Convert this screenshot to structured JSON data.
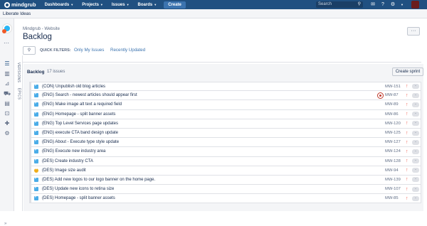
{
  "topnav": {
    "logo": "mindgrub",
    "items": [
      {
        "label": "Dashboards"
      },
      {
        "label": "Projects"
      },
      {
        "label": "Issues"
      },
      {
        "label": "Boards"
      }
    ],
    "create_label": "Create",
    "search_placeholder": "Search"
  },
  "project_bar": {
    "title": "Liberate Ideas"
  },
  "sidebar": {
    "vtabs": [
      "VERSIONS",
      "EPICS"
    ],
    "collapse": "»"
  },
  "header": {
    "breadcrumb": "Mindgrub - Website",
    "title": "Backlog",
    "more": "···"
  },
  "quick_filters": {
    "label": "QUICK FILTERS:",
    "links": [
      "Only My Issues",
      "Recently Updated"
    ]
  },
  "backlog": {
    "title": "Backlog",
    "count": "17 issues",
    "create_sprint_label": "Create sprint",
    "issues": [
      {
        "type": "task",
        "summary": "(CON) Unpublish old blog articles",
        "key": "MW-151",
        "est": "-",
        "avatar": false
      },
      {
        "type": "task",
        "summary": "(ENG) Search - newest articles should appear first",
        "key": "MW-87",
        "est": "-",
        "avatar": true
      },
      {
        "type": "task",
        "summary": "(ENG) Make image alt text a required field",
        "key": "MW-89",
        "est": "-",
        "avatar": false
      },
      {
        "type": "task",
        "summary": "(ENG) Homepage - split banner assets",
        "key": "MW-86",
        "est": "-",
        "avatar": false
      },
      {
        "type": "task",
        "summary": "(ENG) Top Level Services page updates",
        "key": "MW-120",
        "est": "-",
        "avatar": false
      },
      {
        "type": "task",
        "summary": "(ENG) execute CTA band design update",
        "key": "MW-125",
        "est": "-",
        "avatar": false
      },
      {
        "type": "task",
        "summary": "(ENG) About - Execute type style update",
        "key": "MW-127",
        "est": "-",
        "avatar": false
      },
      {
        "type": "task",
        "summary": "(ENG) Execute new industry area",
        "key": "MW-124",
        "est": "-",
        "avatar": false
      },
      {
        "type": "task",
        "summary": "(DES) Create industry CTA",
        "key": "MW-128",
        "est": "-",
        "avatar": false
      },
      {
        "type": "improvement",
        "summary": "(DES) Image size audit",
        "key": "MW-94",
        "est": "-",
        "avatar": false
      },
      {
        "type": "task",
        "summary": "(DES) Add new logos to our logo banner on the home page.",
        "key": "MW-139",
        "est": "-",
        "avatar": false
      },
      {
        "type": "task",
        "summary": "(DES) Update new icons to retina size",
        "key": "MW-107",
        "est": "-",
        "avatar": false
      },
      {
        "type": "task",
        "summary": "(DES) Homepage - split banner assets",
        "key": "MW-85",
        "est": "-",
        "avatar": false
      }
    ]
  },
  "colors": {
    "topnav": "#205081",
    "link": "#3b73af",
    "priority": "#f15c4b",
    "task_icon": "#4bade8",
    "improvement_icon": "#f0ae1c"
  }
}
